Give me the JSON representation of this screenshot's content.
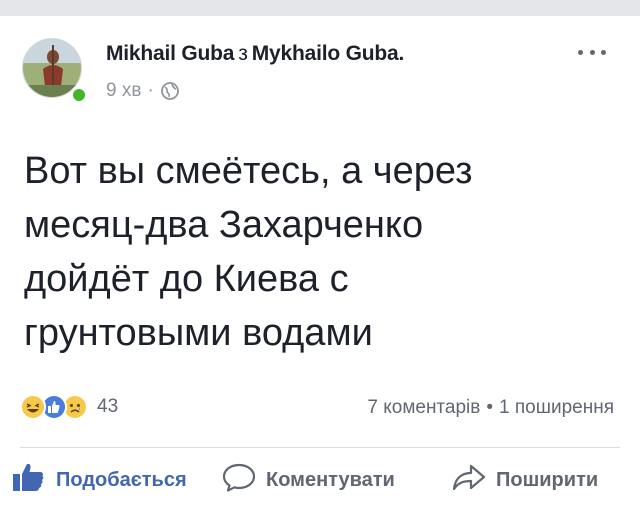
{
  "post": {
    "author": "Mikhail Guba",
    "connector": "з",
    "target": "Mykhailo Guba.",
    "time": "9 хв",
    "text_lines": [
      "Вот вы смеётесь, а через",
      "месяц-два Захарченко",
      "дойдёт до Киева с",
      "грунтовыми водами"
    ]
  },
  "reactions": {
    "icons": [
      "haha-icon",
      "like-icon",
      "sad-icon"
    ],
    "count": "43"
  },
  "stats": {
    "comments": "7 коментарів",
    "shares": "1 поширення"
  },
  "actions": {
    "like_label": "Подобається",
    "comment_label": "Коментувати",
    "share_label": "Поширити"
  },
  "colors": {
    "like_blue": "#4267b2",
    "online_green": "#42b72a",
    "meta_gray": "#90949c"
  }
}
